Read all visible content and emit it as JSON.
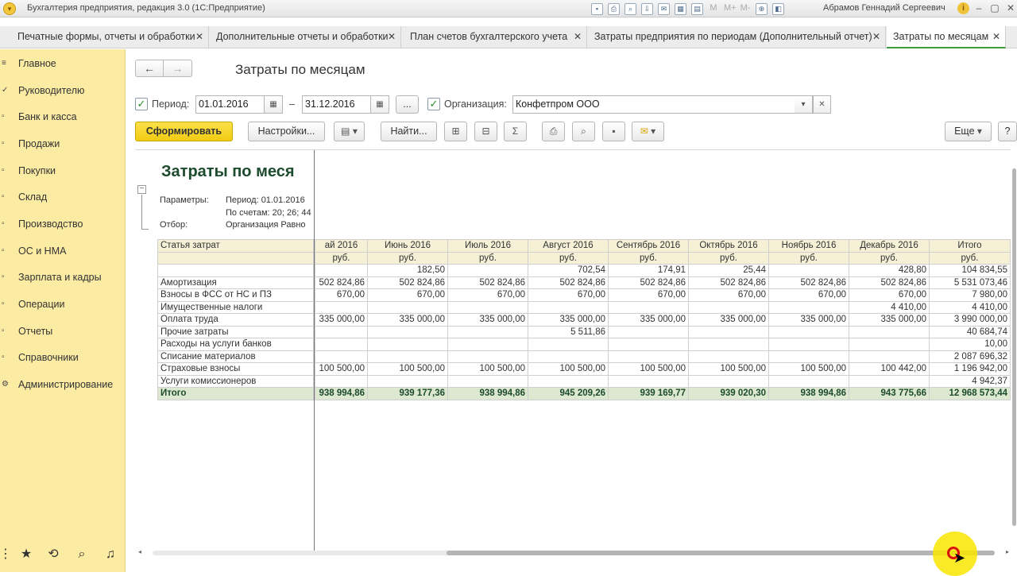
{
  "window": {
    "app_title": "Бухгалтерия предприятия, редакция 3.0  (1С:Предприятие)",
    "user_name": "Абрамов Геннадий Сергеевич"
  },
  "tabs": [
    {
      "label": "Печатные формы, отчеты и обработки"
    },
    {
      "label": "Дополнительные отчеты и обработки"
    },
    {
      "label": "План счетов бухгалтерского учета"
    },
    {
      "label": "Затраты предприятия по периодам (Дополнительный отчет)"
    },
    {
      "label": "Затраты по месяцам"
    }
  ],
  "sidebar": {
    "items": [
      {
        "label": "Главное"
      },
      {
        "label": "Руководителю"
      },
      {
        "label": "Банк и касса"
      },
      {
        "label": "Продажи"
      },
      {
        "label": "Покупки"
      },
      {
        "label": "Склад"
      },
      {
        "label": "Производство"
      },
      {
        "label": "ОС и НМА"
      },
      {
        "label": "Зарплата и кадры"
      },
      {
        "label": "Операции"
      },
      {
        "label": "Отчеты"
      },
      {
        "label": "Справочники"
      },
      {
        "label": "Администрирование"
      }
    ]
  },
  "form": {
    "title": "Затраты по месяцам",
    "period_label": "Период:",
    "period_from": "01.01.2016",
    "period_dash": "–",
    "period_to": "31.12.2016",
    "ellipsis": "...",
    "org_label": "Организация:",
    "org_value": "Конфетпром ООО",
    "form_button": "Сформировать",
    "settings_button": "Настройки...",
    "find_button": "Найти...",
    "more_button": "Еще",
    "help_button": "?"
  },
  "report": {
    "title": "Затраты по меся",
    "params_label": "Параметры:",
    "params_period": "Период: 01.01.2016",
    "params_accounts": "По счетам: 20; 26; 44",
    "filter_label": "Отбор:",
    "filter_value": "Организация Равно",
    "header_item": "Статья затрат",
    "months": [
      "ай 2016",
      "Июнь 2016",
      "Июль 2016",
      "Август 2016",
      "Сентябрь 2016",
      "Октябрь 2016",
      "Ноябрь 2016",
      "Декабрь 2016",
      "Итого"
    ],
    "unit": "руб.",
    "rows": [
      {
        "label": "",
        "values": [
          "",
          "182,50",
          "",
          "702,54",
          "174,91",
          "25,44",
          "",
          "428,80",
          "104 834,55"
        ]
      },
      {
        "label": "Амортизация",
        "values": [
          "502 824,86",
          "502 824,86",
          "502 824,86",
          "502 824,86",
          "502 824,86",
          "502 824,86",
          "502 824,86",
          "502 824,86",
          "5 531 073,46"
        ]
      },
      {
        "label": "Взносы в ФСС от НС и ПЗ",
        "values": [
          "670,00",
          "670,00",
          "670,00",
          "670,00",
          "670,00",
          "670,00",
          "670,00",
          "670,00",
          "7 980,00"
        ]
      },
      {
        "label": "Имущественные налоги",
        "values": [
          "",
          "",
          "",
          "",
          "",
          "",
          "",
          "4 410,00",
          "4 410,00"
        ]
      },
      {
        "label": "Оплата труда",
        "values": [
          "335 000,00",
          "335 000,00",
          "335 000,00",
          "335 000,00",
          "335 000,00",
          "335 000,00",
          "335 000,00",
          "335 000,00",
          "3 990 000,00"
        ]
      },
      {
        "label": "Прочие затраты",
        "values": [
          "",
          "",
          "",
          "5 511,86",
          "",
          "",
          "",
          "",
          "40 684,74"
        ]
      },
      {
        "label": "Расходы на услуги банков",
        "values": [
          "",
          "",
          "",
          "",
          "",
          "",
          "",
          "",
          "10,00"
        ]
      },
      {
        "label": "Списание материалов",
        "values": [
          "",
          "",
          "",
          "",
          "",
          "",
          "",
          "",
          "2 087 696,32"
        ]
      },
      {
        "label": "Страховые взносы",
        "values": [
          "100 500,00",
          "100 500,00",
          "100 500,00",
          "100 500,00",
          "100 500,00",
          "100 500,00",
          "100 500,00",
          "100 442,00",
          "1 196 942,00"
        ]
      },
      {
        "label": "Услуги комиссионеров",
        "values": [
          "",
          "",
          "",
          "",
          "",
          "",
          "",
          "",
          "4 942,37"
        ]
      }
    ],
    "total": {
      "label": "Итого",
      "values": [
        "938 994,86",
        "939 177,36",
        "938 994,86",
        "945 209,26",
        "939 169,77",
        "939 020,30",
        "938 994,86",
        "943 775,66",
        "12 968 573,44"
      ]
    }
  },
  "colors": {
    "sidebar_bg": "#fbeba3",
    "primary_button": "#f1cb12",
    "active_tab_underline": "#3d9a3d",
    "report_header_bg": "#f6f0d6",
    "report_total_bg": "#dce8d0"
  }
}
